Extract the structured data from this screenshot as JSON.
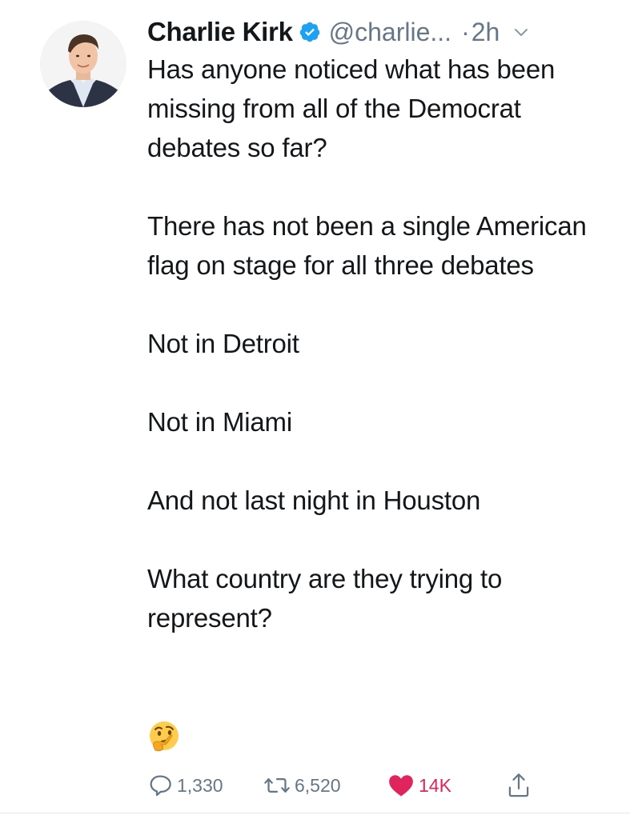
{
  "tweet": {
    "author": {
      "display_name": "Charlie Kirk",
      "handle": "@charlie...",
      "verified": true,
      "avatar_icon": "avatar-photo"
    },
    "meta": {
      "separator": "·",
      "time": "2h",
      "menu_icon": "chevron-down-icon"
    },
    "paragraphs": [
      "Has anyone noticed what has been missing from all of the Democrat debates so far?",
      "There has not been a single American flag on stage for all three debates",
      "Not in Detroit",
      "Not in Miami",
      "And not last night in Houston",
      "What country are they trying to represent?"
    ],
    "emoji": {
      "glyph": "🤔",
      "icon": "thinking-face-emoji"
    },
    "actions": {
      "reply": {
        "icon": "reply-icon",
        "count": "1,330"
      },
      "retweet": {
        "icon": "retweet-icon",
        "count": "6,520"
      },
      "like": {
        "icon": "heart-icon",
        "count": "14K",
        "liked": true
      },
      "share": {
        "icon": "share-icon"
      }
    },
    "colors": {
      "text": "#14171a",
      "secondary": "#657786",
      "verified_blue": "#1da1f2",
      "like_red": "#e0245e"
    }
  }
}
